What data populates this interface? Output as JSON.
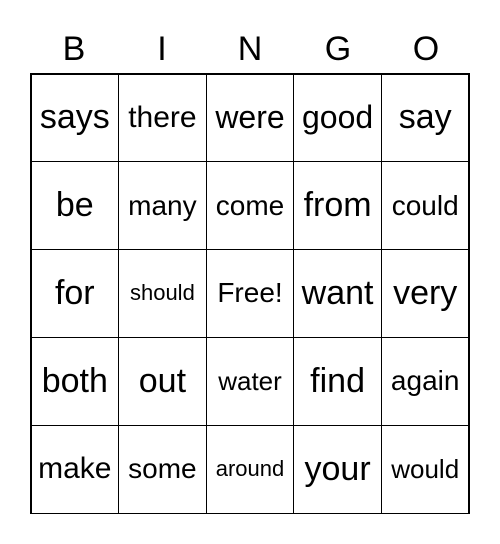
{
  "header": [
    "B",
    "I",
    "N",
    "G",
    "O"
  ],
  "cells": [
    "says",
    "there",
    "were",
    "good",
    "say",
    "be",
    "many",
    "come",
    "from",
    "could",
    "for",
    "should",
    "Free!",
    "want",
    "very",
    "both",
    "out",
    "water",
    "find",
    "again",
    "make",
    "some",
    "around",
    "your",
    "would"
  ]
}
